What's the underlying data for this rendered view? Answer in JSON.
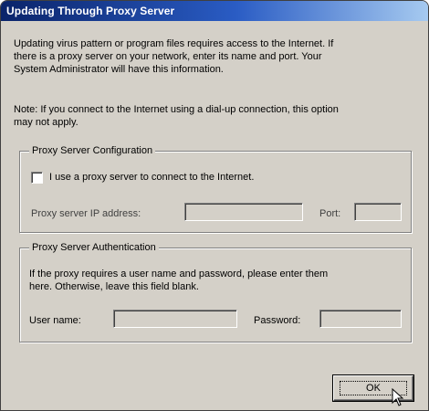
{
  "window": {
    "title": "Updating Through Proxy Server"
  },
  "intro": {
    "line1": "Updating virus pattern or program files requires access to the Internet. If",
    "line2": "there is a proxy server on your network, enter its name and port. Your",
    "line3": "System Administrator will have this information."
  },
  "note": {
    "line1": "Note: If you connect to the Internet using a dial-up connection, this option",
    "line2": "may not apply."
  },
  "proxy_config": {
    "legend": "Proxy Server Configuration",
    "use_proxy_label": "I use a proxy server to connect to the Internet.",
    "use_proxy_checked": false,
    "ip_label": "Proxy server IP address:",
    "ip_value": "",
    "port_label": "Port:",
    "port_value": ""
  },
  "proxy_auth": {
    "legend": "Proxy Server Authentication",
    "line1": "If the proxy requires a user name and password, please enter them",
    "line2": "here. Otherwise, leave this field blank.",
    "username_label": "User name:",
    "username_value": "",
    "password_label": "Password:",
    "password_value": ""
  },
  "buttons": {
    "ok_label": "OK"
  },
  "colors": {
    "title_gradient_start": "#0a246a",
    "title_gradient_end": "#a6caf0",
    "dialog_face": "#d4d0c8"
  },
  "icons": {
    "cursor": "arrow-pointer-icon"
  }
}
